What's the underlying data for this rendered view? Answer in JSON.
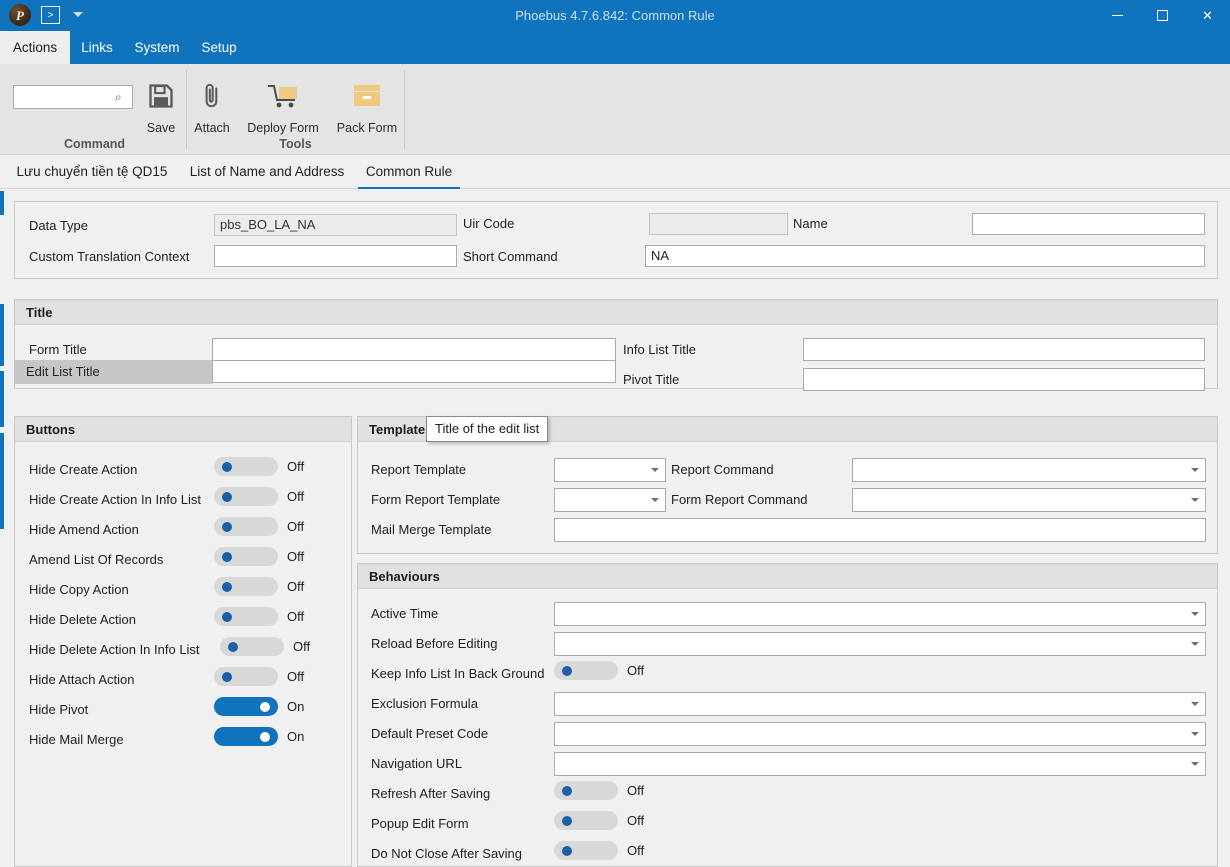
{
  "window": {
    "title": "Phoebus 4.7.6.842: Common Rule",
    "logo_glyph": "P",
    "quick_access_glyph": ">",
    "minimize_label": "",
    "maximize_label": "",
    "close_label": "✕",
    "collapse_ribbon_label": "⌃",
    "help_label": "?"
  },
  "menu": {
    "tabs": [
      {
        "label": "Actions",
        "active": true
      },
      {
        "label": "Links",
        "active": false
      },
      {
        "label": "System",
        "active": false
      },
      {
        "label": "Setup",
        "active": false
      }
    ]
  },
  "ribbon": {
    "search": {
      "value": "",
      "placeholder": ""
    },
    "groups": [
      {
        "label": "Command"
      },
      {
        "label": "Tools"
      }
    ],
    "buttons": [
      {
        "label": "Save",
        "icon": "save-icon"
      },
      {
        "label": "Attach",
        "icon": "paperclip-icon"
      },
      {
        "label": "Deploy Form",
        "icon": "deploy-cart-icon"
      },
      {
        "label": "Pack Form",
        "icon": "package-box-icon"
      }
    ]
  },
  "doc_tabs": [
    {
      "label": "Lưu chuyển tiền tệ QD15",
      "active": false
    },
    {
      "label": "List of Name and Address",
      "active": false
    },
    {
      "label": "Common Rule",
      "active": true
    }
  ],
  "header_fields": {
    "data_type": {
      "label": "Data Type",
      "value": "pbs_BO_LA_NA",
      "disabled": true
    },
    "uir_code": {
      "label": "Uir Code",
      "value": "",
      "disabled": true
    },
    "name": {
      "label": "Name",
      "value": "",
      "disabled": false
    },
    "custom_translation_context": {
      "label": "Custom Translation Context",
      "value": "",
      "disabled": false
    },
    "short_command": {
      "label": "Short Command",
      "value": "NA",
      "disabled": false
    }
  },
  "title_section": {
    "heading": "Title",
    "form_title": {
      "label": "Form Title",
      "value": ""
    },
    "info_list_title": {
      "label": "Info List Title",
      "value": ""
    },
    "edit_list_title": {
      "label": "Edit List Title",
      "value": "",
      "highlighted": true
    },
    "pivot_title": {
      "label": "Pivot Title",
      "value": ""
    }
  },
  "tooltip": {
    "text": "Title of the edit list"
  },
  "buttons_section": {
    "heading": "Buttons",
    "rows": [
      {
        "label": "Hide Create Action",
        "state": "Off",
        "on": false
      },
      {
        "label": "Hide Create Action In Info List",
        "state": "Off",
        "on": false
      },
      {
        "label": "Hide Amend Action",
        "state": "Off",
        "on": false
      },
      {
        "label": "Amend List Of Records",
        "state": "Off",
        "on": false
      },
      {
        "label": "Hide Copy Action",
        "state": "Off",
        "on": false
      },
      {
        "label": "Hide Delete Action",
        "state": "Off",
        "on": false
      },
      {
        "label": "Hide Delete Action In Info List",
        "state": "Off",
        "on": false
      },
      {
        "label": "Hide Attach Action",
        "state": "Off",
        "on": false
      },
      {
        "label": "Hide Pivot",
        "state": "On",
        "on": true
      },
      {
        "label": "Hide Mail Merge",
        "state": "On",
        "on": true
      }
    ]
  },
  "template_section": {
    "heading": "Template",
    "report_template": {
      "label": "Report Template",
      "value": ""
    },
    "report_command": {
      "label": "Report Command",
      "value": ""
    },
    "form_report_template": {
      "label": "Form Report Template",
      "value": ""
    },
    "form_report_command": {
      "label": "Form Report Command",
      "value": ""
    },
    "mail_merge_template": {
      "label": "Mail Merge Template",
      "value": ""
    }
  },
  "behaviours_section": {
    "heading": "Behaviours",
    "rows": [
      {
        "label": "Active Time",
        "type": "combo",
        "value": ""
      },
      {
        "label": "Reload Before Editing",
        "type": "combo",
        "value": ""
      },
      {
        "label": "Keep Info List In Back Ground",
        "type": "toggle",
        "state": "Off",
        "on": false
      },
      {
        "label": "Exclusion Formula",
        "type": "combo",
        "value": ""
      },
      {
        "label": "Default Preset Code",
        "type": "combo",
        "value": ""
      },
      {
        "label": "Navigation URL",
        "type": "combo",
        "value": ""
      },
      {
        "label": "Refresh After Saving",
        "type": "toggle",
        "state": "Off",
        "on": false
      },
      {
        "label": "Popup Edit Form",
        "type": "toggle",
        "state": "Off",
        "on": false
      },
      {
        "label": "Do Not Close After Saving",
        "type": "toggle",
        "state": "Off",
        "on": false
      }
    ]
  },
  "colors": {
    "accent": "#1073bd",
    "panel_bg": "#f0f0f0",
    "ribbon_bg": "#e4e4e4",
    "toggle_on": "#1073bd",
    "toggle_off": "#d8d8d8",
    "icon_gold": "#efc980"
  }
}
